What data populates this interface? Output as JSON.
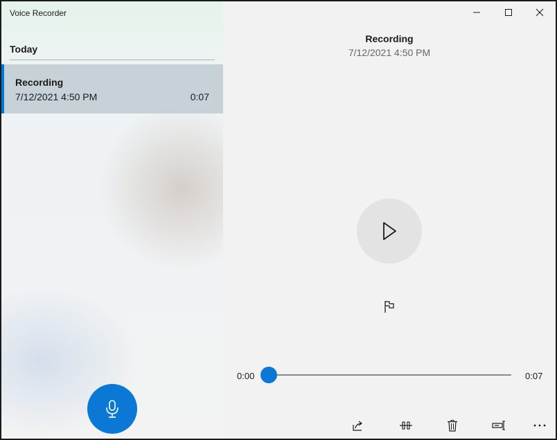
{
  "app": {
    "title": "Voice Recorder"
  },
  "list": {
    "group_header": "Today",
    "items": [
      {
        "name": "Recording",
        "date": "7/12/2021 4:50 PM",
        "duration": "0:07"
      }
    ]
  },
  "player": {
    "title": "Recording",
    "subtitle": "7/12/2021 4:50 PM",
    "time_current": "0:00",
    "time_total": "0:07",
    "progress": 0
  },
  "icons": {
    "record": "microphone-icon",
    "play": "play-icon",
    "marker": "flag-icon",
    "share": "share-icon",
    "trim": "trim-icon",
    "delete": "trash-icon",
    "rename": "rename-icon",
    "more": "more-icon",
    "minimize": "minimize-icon",
    "maximize": "maximize-icon",
    "close": "close-icon"
  },
  "colors": {
    "accent": "#0078d7",
    "selected_item": "#bfcbd2",
    "play_button": "#e3e3e3"
  }
}
